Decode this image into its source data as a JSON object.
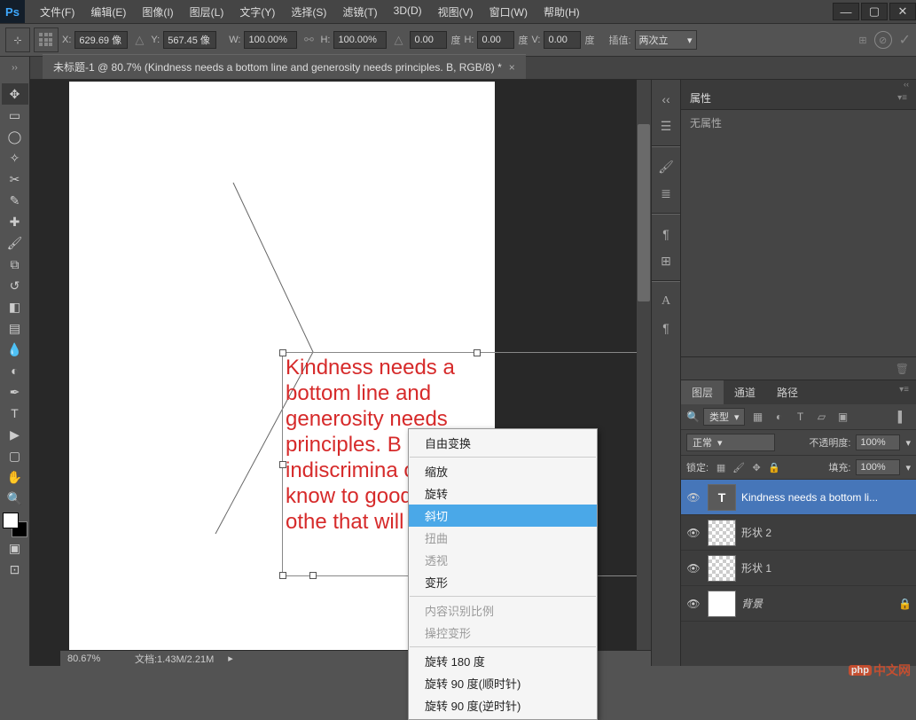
{
  "logo": "Ps",
  "menu": {
    "file": "文件(F)",
    "edit": "编辑(E)",
    "image": "图像(I)",
    "layer": "图层(L)",
    "type": "文字(Y)",
    "select": "选择(S)",
    "filter": "滤镜(T)",
    "threed": "3D(D)",
    "view": "视图(V)",
    "window": "窗口(W)",
    "help": "帮助(H)"
  },
  "options": {
    "x_label": "X:",
    "x_value": "629.69 像",
    "y_label": "Y:",
    "y_value": "567.45 像",
    "w_label": "W:",
    "w_value": "100.00%",
    "h_label": "H:",
    "h_value": "100.00%",
    "angle1_value": "0.00",
    "angle1_unit": "度",
    "hskew_label": "H:",
    "hskew_value": "0.00",
    "hskew_unit": "度",
    "vskew_label": "V:",
    "vskew_value": "0.00",
    "vskew_unit": "度",
    "interp_label": "插值:",
    "interp_value": "两次立"
  },
  "doc_tab": "未标题-1 @ 80.7% (Kindness needs a bottom line and generosity needs principles. B, RGB/8) *",
  "canvas_text": "Kindness needs a bottom line and generosity needs principles. B indiscrimina only know to good to othe that will disa",
  "context_menu": {
    "free_transform": "自由变换",
    "scale": "缩放",
    "rotate": "旋转",
    "skew": "斜切",
    "distort": "扭曲",
    "perspective": "透视",
    "warp": "变形",
    "content_aware": "内容识别比例",
    "puppet": "操控变形",
    "rotate180": "旋转 180 度",
    "rotate90cw": "旋转 90 度(顺时针)",
    "rotate90ccw": "旋转 90 度(逆时针)"
  },
  "props_panel": {
    "tab": "属性",
    "none": "无属性"
  },
  "layers_panel": {
    "tab_layers": "图层",
    "tab_channels": "通道",
    "tab_paths": "路径",
    "kind": "类型",
    "blend_mode": "正常",
    "opacity_label": "不透明度:",
    "opacity_value": "100%",
    "lock_label": "锁定:",
    "fill_label": "填充:",
    "fill_value": "100%",
    "layers": [
      {
        "name": "Kindness needs a bottom li...",
        "type": "T"
      },
      {
        "name": "形状 2",
        "type": "shape"
      },
      {
        "name": "形状 1",
        "type": "shape"
      },
      {
        "name": "背景",
        "type": "bg"
      }
    ]
  },
  "status": {
    "zoom": "80.67%",
    "doc": "文档:1.43M/2.21M"
  },
  "watermark": "中文网"
}
